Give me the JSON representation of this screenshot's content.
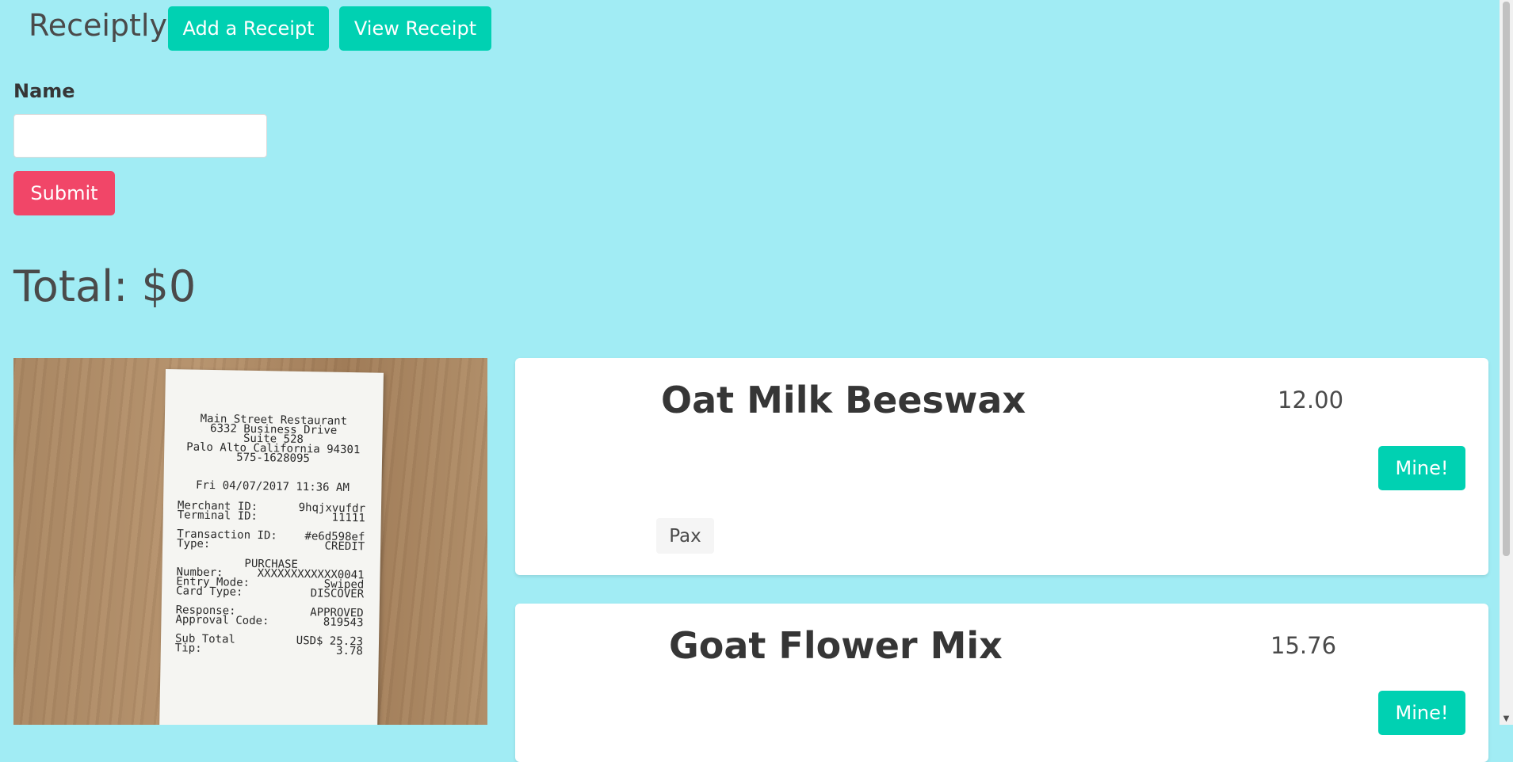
{
  "nav": {
    "brand": "Receiptly",
    "add_label": "Add a Receipt",
    "view_label": "View Receipt"
  },
  "form": {
    "name_label": "Name",
    "name_value": "",
    "submit_label": "Submit"
  },
  "total": "Total: $0",
  "receipt": {
    "merchant": "Main Street Restaurant",
    "address1": "6332 Business Drive",
    "address2": "Suite 528",
    "city": "Palo Alto California 94301",
    "phone": "575-1628095",
    "datetime": "Fri 04/07/2017 11:36 AM",
    "merchant_id_label": "Merchant ID:",
    "merchant_id": "9hqjxvufdr",
    "terminal_id_label": "Terminal ID:",
    "terminal_id": "11111",
    "transaction_id_label": "Transaction ID:",
    "transaction_id": "#e6d598ef",
    "type_label": "Type:",
    "type": "CREDIT",
    "purchase": "PURCHASE",
    "number_label": "Number:",
    "number": "XXXXXXXXXXXX0041",
    "entry_mode_label": "Entry Mode:",
    "entry_mode": "Swiped",
    "card_type_label": "Card Type:",
    "card_type": "DISCOVER",
    "response_label": "Response:",
    "response": "APPROVED",
    "approval_label": "Approval Code:",
    "approval": "819543",
    "subtotal_label": "Sub Total",
    "subtotal": "USD$ 25.23",
    "tip_label": "Tip:",
    "tip": "3.78"
  },
  "items": [
    {
      "name": "Oat Milk Beeswax",
      "price": "12.00",
      "action_label": "Mine!",
      "tag": "Pax"
    },
    {
      "name": "Goat Flower Mix",
      "price": "15.76",
      "action_label": "Mine!"
    }
  ],
  "colors": {
    "background": "#a1ecf4",
    "primary": "#00d1b2",
    "danger": "#f14668"
  }
}
